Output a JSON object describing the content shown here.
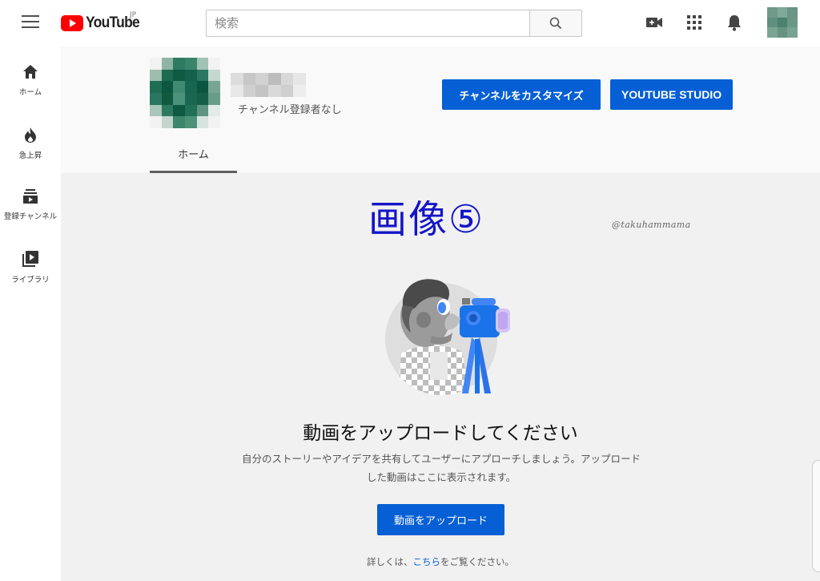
{
  "topbar": {
    "logo_text": "YouTube",
    "region": "JP",
    "search_placeholder": "検索"
  },
  "icons": {
    "menu": "hamburger-menu-icon",
    "search": "search-icon",
    "create": "video-camera-plus-icon",
    "apps": "apps-grid-icon",
    "notifications": "bell-icon"
  },
  "sidebar": {
    "items": [
      {
        "label": "ホーム",
        "icon": "home-icon"
      },
      {
        "label": "急上昇",
        "icon": "flame-icon"
      },
      {
        "label": "登録チャンネル",
        "icon": "subscriptions-icon"
      },
      {
        "label": "ライブラリ",
        "icon": "library-icon"
      }
    ]
  },
  "channel": {
    "subscribers": "チャンネル登録者なし",
    "customize_button": "チャンネルをカスタマイズ",
    "studio_button": "YOUTUBE STUDIO",
    "tabs": [
      {
        "label": "ホーム"
      }
    ]
  },
  "overlay": {
    "title": "画像⑤",
    "watermark": "@takuhammama"
  },
  "main": {
    "heading": "動画をアップロードしてください",
    "description": "自分のストーリーやアイデアを共有してユーザーにアプローチしましょう。アップロードした動画はここに表示されます。",
    "upload_button": "動画をアップロード",
    "learn_more_prefix": "詳しくは、",
    "learn_more_link": "こちら",
    "learn_more_suffix": "をご覧ください。"
  },
  "colors": {
    "brand_red": "#ff0000",
    "primary_blue": "#065fd4",
    "overlay_blue": "#1515c8",
    "avatar_green": "#1e6b50"
  }
}
